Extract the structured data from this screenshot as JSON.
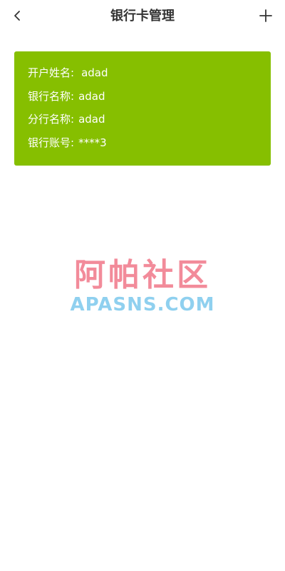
{
  "header": {
    "title": "银行卡管理",
    "back_icon": "chevron-left-icon",
    "add_icon": "plus-icon"
  },
  "card": {
    "background_color": "#86bf00",
    "rows": [
      {
        "label": "开户姓名:",
        "value": "adad"
      },
      {
        "label": "银行名称:",
        "value": "adad"
      },
      {
        "label": "分行名称:",
        "value": "adad"
      },
      {
        "label": "银行账号:",
        "value": "****3"
      }
    ]
  },
  "watermark": {
    "chinese": "阿帕社区",
    "english": "APASNS.COM",
    "chinese_color": "#f28b9a",
    "english_color": "#8fd0ef"
  }
}
